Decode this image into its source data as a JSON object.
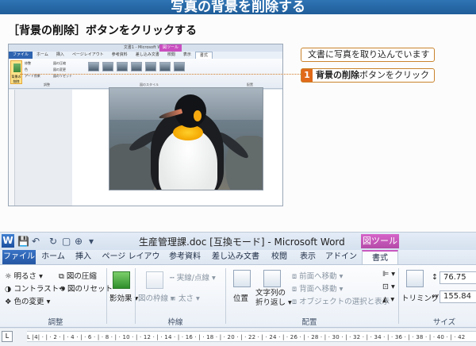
{
  "banner": {
    "title": "写真の背景を削除する"
  },
  "heading": "［背景の削除］ボタンをクリックする",
  "callouts": {
    "note": "文書に写真を取り込んでいます",
    "step_number": "1",
    "step_bold": "背景の削除",
    "step_text": "ボタンをクリック"
  },
  "mini": {
    "title": "文書1 - Microsoft Word",
    "context": "図ツール",
    "tabs": [
      "ファイル",
      "ホーム",
      "挿入",
      "ページレイアウト",
      "参考資料",
      "差し込み文書",
      "校閲",
      "表示",
      "書式"
    ],
    "bg_button": "背景の削除",
    "items": [
      "修整",
      "色",
      "アート効果",
      "図の圧縮",
      "図の変更",
      "図のリセット"
    ],
    "groups": [
      "調整",
      "図のスタイル",
      "配置"
    ]
  },
  "word": {
    "logo": "W",
    "qat": [
      "💾",
      "↶",
      "↻",
      "▢",
      "⊕",
      "▾"
    ],
    "title": "生産管理課.doc [互換モード] - Microsoft Word",
    "context_tab": "図ツール",
    "tabs": [
      "ファイル",
      "ホーム",
      "挿入",
      "ページ レイアウト",
      "参考資料",
      "差し込み文書",
      "校閲",
      "表示",
      "アドイン",
      "書式"
    ],
    "ribbon": {
      "brightness": "明るさ",
      "contrast": "コントラスト",
      "recolor": "色の変更",
      "compress": "図の圧縮",
      "reset": "図のリセット",
      "shadow": "影効果",
      "picture_border": "図の枠線",
      "dash": "実線/点線",
      "weight": "太さ",
      "position": "位置",
      "wrap": "文字列の\n折り返し",
      "bring_forward": "前面へ移動",
      "send_backward": "背面へ移動",
      "selection": "オブジェクトの選択と表示",
      "trimming": "トリミング",
      "height": "76.75 mm",
      "width": "155.84 mm"
    },
    "groups": [
      "調整",
      "枠線",
      "配置",
      "サイズ"
    ],
    "ruler": "L   |4| · | · 2 · | · 4 · | · 6 · | · 8 · | · 10 · | · 12 · | · 14 · | · 16 · | · 18 · | · 20 · | · 22 · | · 24 · | · 26 · | · 28 · | · 30 · | · 32 · | · 34 · | · 36 · | · 38 · | · 40 · | · 42"
  }
}
